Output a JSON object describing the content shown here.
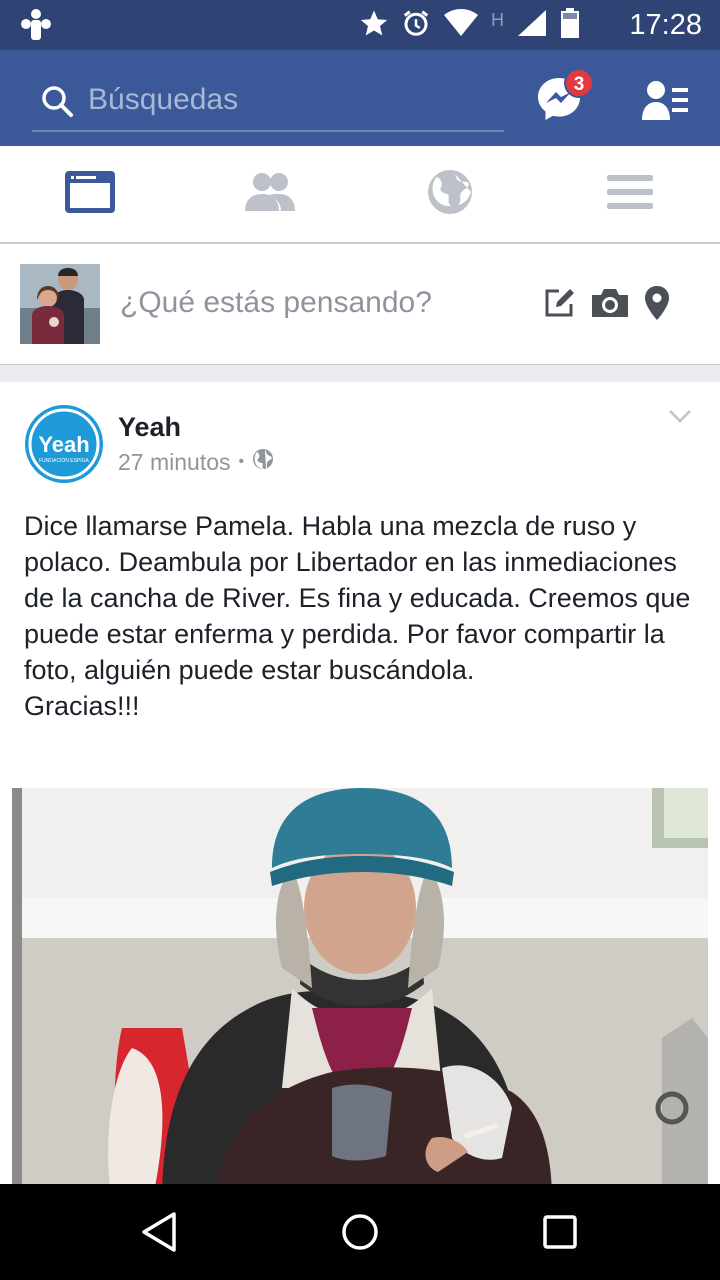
{
  "status_bar": {
    "time": "17:28",
    "network_label": "H",
    "icons": [
      "app-notification-icon",
      "star-icon",
      "alarm-icon",
      "wifi-icon",
      "signal-icon",
      "battery-icon"
    ]
  },
  "header": {
    "search_placeholder": "Búsquedas",
    "messenger_badge": "3",
    "colors": {
      "primary": "#3b5998",
      "status_bar": "#2f4374",
      "badge": "#e0393e"
    }
  },
  "tabs": [
    {
      "name": "news-feed",
      "icon": "news-feed-icon",
      "active": true
    },
    {
      "name": "friends",
      "icon": "friends-icon",
      "active": false
    },
    {
      "name": "notifications",
      "icon": "globe-icon",
      "active": false
    },
    {
      "name": "menu",
      "icon": "menu-icon",
      "active": false
    }
  ],
  "composer": {
    "prompt": "¿Qué estás pensando?",
    "icons": [
      "edit-icon",
      "camera-icon",
      "location-pin-icon"
    ]
  },
  "post": {
    "author": "Yeah",
    "logo_text": "Yeah",
    "logo_subtext": "FUNDACIÓN ESPIGA",
    "time": "27 minutos",
    "separator": "•",
    "privacy_icon": "public-globe-icon",
    "text": "Dice llamarse Pamela. Habla una mezcla de ruso y polaco. Deambula por Libertador en las inmediaciones de la cancha de River. Es fina y educada. Creemos que puede estar enferma y perdida. Por favor compartir la foto, alguién puede estar buscándola.\nGracias!!!"
  },
  "nav_bar": {
    "buttons": [
      "back-icon",
      "home-icon",
      "recents-icon"
    ]
  }
}
